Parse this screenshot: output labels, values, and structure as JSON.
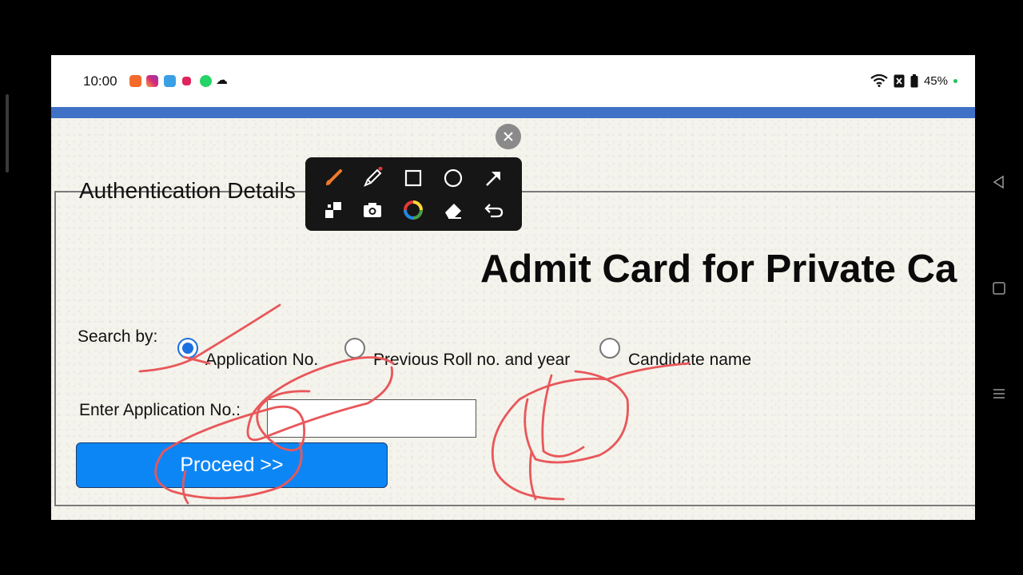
{
  "status": {
    "time": "10:00",
    "battery": "45%"
  },
  "page": {
    "section_title": "Authentication Details",
    "heading": "Admit Card for Private Ca"
  },
  "form": {
    "search_by_label": "Search by:",
    "options": [
      {
        "label": "Application No.",
        "selected": true
      },
      {
        "label": "Previous Roll no. and year",
        "selected": false
      },
      {
        "label": "Candidate name",
        "selected": false
      }
    ],
    "field_label": "Enter Application No.:",
    "field_value": "",
    "submit_label": "Proceed >>"
  },
  "toolbar": {
    "tools": [
      "brush-icon",
      "highlighter-icon",
      "rectangle-icon",
      "circle-icon",
      "arrow-icon",
      "mosaic-icon",
      "camera-icon",
      "color-picker-icon",
      "eraser-icon",
      "undo-icon"
    ]
  },
  "colors": {
    "accent": "#1b6fe0",
    "button": "#0d86f5",
    "band": "#3f72c6",
    "annotation": "#e8575a"
  }
}
